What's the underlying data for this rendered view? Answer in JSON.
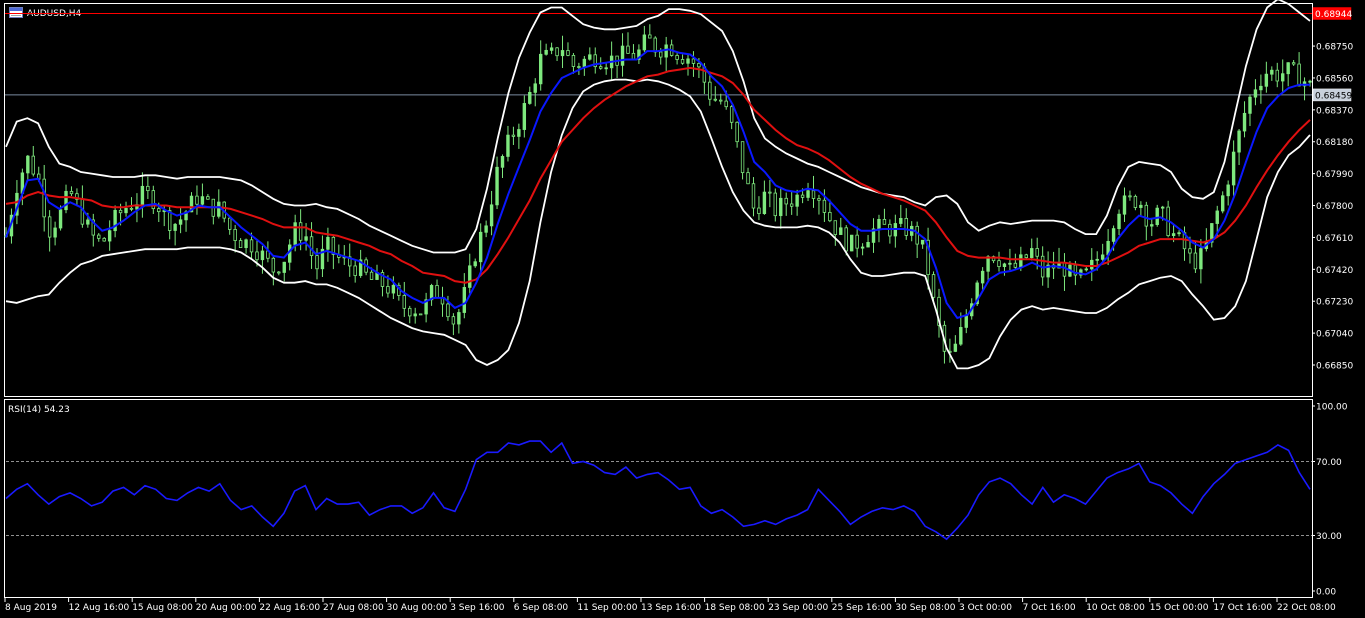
{
  "window": {
    "symbol_title": "AUDUSD,H4",
    "rsi_label": "RSI(14) 54.23"
  },
  "colors": {
    "background": "#000000",
    "frame": "#ffffff",
    "candle": "#7ee87e",
    "bollinger": "#ffffff",
    "ma_fast": "#0a18ff",
    "ma_slow": "#e01010",
    "rsi": "#1a1aff",
    "alert_line": "#ff0000",
    "current_price_line": "#7a8ba0"
  },
  "icons": {
    "chart_window": "chart-window-icon"
  },
  "chart_data": [
    {
      "type": "candlestick",
      "title": "AUDUSD,H4",
      "ylim": [
        0.6677,
        0.6903
      ],
      "y_ticks": [
        "0.68750",
        "0.68560",
        "0.68370",
        "0.68180",
        "0.67990",
        "0.67800",
        "0.67610",
        "0.67420",
        "0.67230",
        "0.67040",
        "0.66850"
      ],
      "x_ticks": [
        "8 Aug 2019",
        "12 Aug 16:00",
        "15 Aug 08:00",
        "20 Aug 00:00",
        "22 Aug 16:00",
        "27 Aug 08:00",
        "30 Aug 00:00",
        "3 Sep 16:00",
        "6 Sep 08:00",
        "11 Sep 00:00",
        "13 Sep 16:00",
        "18 Sep 08:00",
        "23 Sep 00:00",
        "25 Sep 16:00",
        "30 Sep 08:00",
        "3 Oct 00:00",
        "7 Oct 16:00",
        "10 Oct 08:00",
        "15 Oct 00:00",
        "17 Oct 16:00",
        "22 Oct 08:00"
      ],
      "price_tags": [
        {
          "name": "alert-level",
          "value": 0.68944,
          "label": "0.68944"
        },
        {
          "name": "current-price",
          "value": 0.68459,
          "label": "0.68459"
        }
      ],
      "series": [
        {
          "name": "close",
          "values": [
            0.6762,
            0.6792,
            0.6808,
            0.6797,
            0.6765,
            0.6774,
            0.6788,
            0.6776,
            0.6762,
            0.6757,
            0.677,
            0.6778,
            0.6782,
            0.6787,
            0.6783,
            0.6772,
            0.6769,
            0.6778,
            0.6786,
            0.6779,
            0.6778,
            0.6765,
            0.6759,
            0.6757,
            0.675,
            0.6742,
            0.6748,
            0.6765,
            0.6763,
            0.6742,
            0.6756,
            0.6749,
            0.6745,
            0.6743,
            0.6736,
            0.6734,
            0.673,
            0.672,
            0.6719,
            0.6717,
            0.673,
            0.6725,
            0.6709,
            0.6729,
            0.6754,
            0.6772,
            0.6801,
            0.6817,
            0.683,
            0.6846,
            0.6867,
            0.6869,
            0.6875,
            0.6863,
            0.6866,
            0.6869,
            0.6867,
            0.6867,
            0.687,
            0.6869,
            0.6879,
            0.6873,
            0.6876,
            0.687,
            0.6868,
            0.6859,
            0.6844,
            0.6842,
            0.6825,
            0.68,
            0.6777,
            0.6786,
            0.6777,
            0.6782,
            0.6785,
            0.6794,
            0.6787,
            0.6773,
            0.6763,
            0.6756,
            0.6759,
            0.6765,
            0.6767,
            0.6766,
            0.6767,
            0.6763,
            0.6751,
            0.6714,
            0.6687,
            0.6697,
            0.6718,
            0.674,
            0.6753,
            0.6748,
            0.6741,
            0.6746,
            0.6753,
            0.6739,
            0.6744,
            0.6743,
            0.6735,
            0.6738,
            0.6747,
            0.6761,
            0.6779,
            0.6782,
            0.6784,
            0.6769,
            0.6776,
            0.6764,
            0.6757,
            0.6746,
            0.675,
            0.677,
            0.6788,
            0.6813,
            0.6838,
            0.6853,
            0.686,
            0.6858,
            0.686,
            0.6857,
            0.6851
          ]
        },
        {
          "name": "ma-fast",
          "values": [
            0.6761,
            0.6778,
            0.6795,
            0.6796,
            0.6782,
            0.6778,
            0.6782,
            0.6779,
            0.6771,
            0.6765,
            0.6767,
            0.6771,
            0.6776,
            0.678,
            0.6781,
            0.6777,
            0.6774,
            0.6776,
            0.678,
            0.6779,
            0.6779,
            0.6773,
            0.6767,
            0.6762,
            0.6757,
            0.675,
            0.6749,
            0.6756,
            0.6758,
            0.6751,
            0.6753,
            0.6751,
            0.6749,
            0.6747,
            0.6743,
            0.6739,
            0.6736,
            0.6729,
            0.6725,
            0.6722,
            0.6725,
            0.6725,
            0.6719,
            0.6722,
            0.6734,
            0.6749,
            0.6769,
            0.6787,
            0.6803,
            0.6819,
            0.6836,
            0.6847,
            0.6856,
            0.6859,
            0.6862,
            0.6864,
            0.6865,
            0.6866,
            0.6867,
            0.6867,
            0.6872,
            0.6872,
            0.6873,
            0.6871,
            0.687,
            0.6865,
            0.6857,
            0.6851,
            0.684,
            0.6824,
            0.6806,
            0.68,
            0.6792,
            0.6789,
            0.6788,
            0.679,
            0.6789,
            0.6783,
            0.6776,
            0.6769,
            0.6765,
            0.6765,
            0.6766,
            0.6766,
            0.6766,
            0.6765,
            0.676,
            0.6743,
            0.6722,
            0.6713,
            0.6715,
            0.6725,
            0.6736,
            0.674,
            0.6741,
            0.6743,
            0.6746,
            0.6743,
            0.6744,
            0.6743,
            0.674,
            0.6739,
            0.6742,
            0.6749,
            0.676,
            0.6768,
            0.6774,
            0.6772,
            0.6773,
            0.677,
            0.6765,
            0.6758,
            0.6755,
            0.676,
            0.6771,
            0.6787,
            0.6806,
            0.6824,
            0.6838,
            0.6845,
            0.685,
            0.6852,
            0.6852
          ]
        },
        {
          "name": "ma-slow",
          "values": [
            0.6781,
            0.6782,
            0.6786,
            0.6788,
            0.6786,
            0.6785,
            0.6785,
            0.6784,
            0.6783,
            0.678,
            0.6779,
            0.6779,
            0.678,
            0.678,
            0.678,
            0.678,
            0.6779,
            0.6779,
            0.6779,
            0.6779,
            0.6779,
            0.6778,
            0.6776,
            0.6774,
            0.6772,
            0.6769,
            0.6767,
            0.6767,
            0.6767,
            0.6764,
            0.6763,
            0.6762,
            0.676,
            0.6758,
            0.6756,
            0.6753,
            0.6751,
            0.6747,
            0.6744,
            0.674,
            0.6739,
            0.6738,
            0.6735,
            0.6734,
            0.6736,
            0.6742,
            0.6751,
            0.6761,
            0.6772,
            0.6783,
            0.6796,
            0.6807,
            0.6818,
            0.6825,
            0.6832,
            0.6838,
            0.6843,
            0.6847,
            0.6851,
            0.6854,
            0.6857,
            0.6858,
            0.686,
            0.6861,
            0.6862,
            0.6861,
            0.6859,
            0.6857,
            0.6853,
            0.6846,
            0.6837,
            0.6831,
            0.6825,
            0.682,
            0.6816,
            0.6814,
            0.6811,
            0.6807,
            0.6802,
            0.6797,
            0.6793,
            0.679,
            0.6787,
            0.6785,
            0.6783,
            0.678,
            0.6777,
            0.677,
            0.6761,
            0.6753,
            0.675,
            0.6749,
            0.6749,
            0.6749,
            0.6748,
            0.6748,
            0.6748,
            0.6747,
            0.6746,
            0.6746,
            0.6745,
            0.6744,
            0.6744,
            0.6746,
            0.6749,
            0.6752,
            0.6756,
            0.6758,
            0.676,
            0.676,
            0.676,
            0.6759,
            0.6758,
            0.676,
            0.6764,
            0.6771,
            0.678,
            0.6791,
            0.6801,
            0.681,
            0.6818,
            0.6825,
            0.6831
          ]
        },
        {
          "name": "bollinger-upper",
          "values": [
            0.6815,
            0.683,
            0.6832,
            0.6829,
            0.6815,
            0.6805,
            0.6803,
            0.68,
            0.6799,
            0.6798,
            0.6797,
            0.6797,
            0.6797,
            0.6798,
            0.6798,
            0.6797,
            0.6796,
            0.6797,
            0.6797,
            0.6797,
            0.6797,
            0.6796,
            0.6795,
            0.6792,
            0.6788,
            0.6784,
            0.6781,
            0.678,
            0.678,
            0.6781,
            0.6779,
            0.6778,
            0.6775,
            0.6772,
            0.6768,
            0.6765,
            0.6762,
            0.6759,
            0.6756,
            0.6754,
            0.6752,
            0.6752,
            0.6752,
            0.6754,
            0.6766,
            0.679,
            0.682,
            0.6847,
            0.6868,
            0.6883,
            0.6895,
            0.6898,
            0.6898,
            0.6893,
            0.6888,
            0.6886,
            0.6885,
            0.6885,
            0.6886,
            0.6887,
            0.6891,
            0.6893,
            0.6897,
            0.6897,
            0.6896,
            0.6894,
            0.6889,
            0.6884,
            0.6872,
            0.6854,
            0.6832,
            0.682,
            0.6815,
            0.6811,
            0.6808,
            0.6805,
            0.6803,
            0.68,
            0.6797,
            0.6794,
            0.6791,
            0.6789,
            0.6787,
            0.6786,
            0.6785,
            0.6782,
            0.678,
            0.6785,
            0.6786,
            0.6781,
            0.677,
            0.6765,
            0.6768,
            0.677,
            0.6769,
            0.677,
            0.6771,
            0.6771,
            0.6771,
            0.677,
            0.6766,
            0.6763,
            0.6763,
            0.6774,
            0.6791,
            0.6803,
            0.6806,
            0.6805,
            0.6804,
            0.68,
            0.679,
            0.6785,
            0.6784,
            0.6788,
            0.6806,
            0.6835,
            0.6863,
            0.6885,
            0.6898,
            0.6903,
            0.69,
            0.6895,
            0.689
          ]
        },
        {
          "name": "bollinger-lower",
          "values": [
            0.6723,
            0.6722,
            0.6724,
            0.6726,
            0.6727,
            0.6734,
            0.674,
            0.6745,
            0.6747,
            0.675,
            0.6751,
            0.6752,
            0.6753,
            0.6754,
            0.6754,
            0.6754,
            0.6754,
            0.6755,
            0.6755,
            0.6755,
            0.6755,
            0.6754,
            0.6752,
            0.6748,
            0.6743,
            0.6737,
            0.6734,
            0.6734,
            0.6735,
            0.6733,
            0.6733,
            0.6731,
            0.6728,
            0.6725,
            0.6721,
            0.6717,
            0.6713,
            0.671,
            0.6707,
            0.6705,
            0.6704,
            0.6703,
            0.67,
            0.6697,
            0.6688,
            0.6685,
            0.6688,
            0.6694,
            0.671,
            0.6735,
            0.677,
            0.68,
            0.6822,
            0.6838,
            0.6848,
            0.6852,
            0.6854,
            0.6855,
            0.6855,
            0.6854,
            0.6855,
            0.6854,
            0.6852,
            0.6849,
            0.6845,
            0.6836,
            0.682,
            0.6803,
            0.6788,
            0.6777,
            0.677,
            0.6768,
            0.6767,
            0.6767,
            0.6767,
            0.6768,
            0.6767,
            0.6764,
            0.6758,
            0.6748,
            0.674,
            0.6738,
            0.6738,
            0.6739,
            0.674,
            0.674,
            0.6738,
            0.6718,
            0.6695,
            0.6683,
            0.6683,
            0.6685,
            0.6689,
            0.6702,
            0.6712,
            0.6718,
            0.672,
            0.6718,
            0.6719,
            0.6718,
            0.6717,
            0.6716,
            0.6716,
            0.6719,
            0.6724,
            0.6728,
            0.6733,
            0.6735,
            0.6737,
            0.6738,
            0.6735,
            0.6727,
            0.672,
            0.6712,
            0.6713,
            0.672,
            0.6735,
            0.676,
            0.6785,
            0.68,
            0.681,
            0.6815,
            0.6822
          ]
        }
      ]
    },
    {
      "type": "line",
      "title": "RSI(14) 54.23",
      "ylim": [
        0,
        100
      ],
      "y_ticks": [
        "100.00",
        "70.00",
        "30.00",
        "0.00"
      ],
      "reference_levels": [
        70,
        30
      ],
      "series": [
        {
          "name": "RSI(14)",
          "values": [
            50,
            55,
            58,
            52,
            47,
            51,
            53,
            50,
            46,
            48,
            54,
            56,
            52,
            57,
            55,
            50,
            49,
            53,
            56,
            54,
            58,
            49,
            44,
            46,
            40,
            35,
            42,
            54,
            57,
            44,
            50,
            47,
            47,
            48,
            41,
            44,
            46,
            46,
            42,
            45,
            53,
            45,
            43,
            55,
            71,
            75,
            75,
            80,
            79,
            81,
            81,
            75,
            80,
            69,
            70,
            68,
            64,
            63,
            67,
            61,
            63,
            64,
            60,
            55,
            56,
            46,
            42,
            44,
            40,
            35,
            36,
            38,
            36,
            39,
            41,
            44,
            55,
            49,
            43,
            36,
            40,
            43,
            45,
            44,
            46,
            43,
            35,
            32,
            28,
            34,
            41,
            52,
            59,
            61,
            58,
            52,
            47,
            56,
            48,
            52,
            50,
            47,
            54,
            61,
            64,
            66,
            69,
            59,
            57,
            53,
            47,
            42,
            51,
            58,
            63,
            69,
            71,
            73,
            75,
            79,
            76,
            64,
            55
          ]
        }
      ]
    }
  ]
}
